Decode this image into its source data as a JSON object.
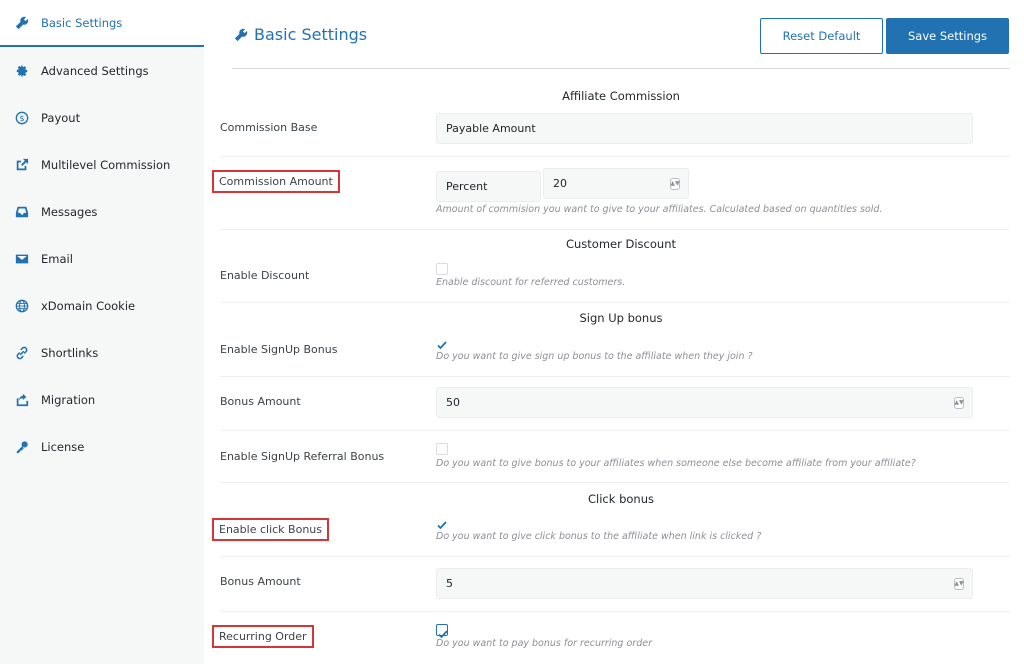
{
  "sidebar": {
    "items": [
      {
        "label": "Basic Settings",
        "icon": "wrench-icon"
      },
      {
        "label": "Advanced Settings",
        "icon": "gear-icon"
      },
      {
        "label": "Payout",
        "icon": "dollar-icon"
      },
      {
        "label": "Multilevel Commission",
        "icon": "external-link-icon"
      },
      {
        "label": "Messages",
        "icon": "inbox-icon"
      },
      {
        "label": "Email",
        "icon": "envelope-icon"
      },
      {
        "label": "xDomain Cookie",
        "icon": "globe-icon"
      },
      {
        "label": "Shortlinks",
        "icon": "link-icon"
      },
      {
        "label": "Migration",
        "icon": "export-icon"
      },
      {
        "label": "License",
        "icon": "key-icon"
      }
    ],
    "active": "Basic Settings"
  },
  "header": {
    "title": "Basic Settings",
    "reset_label": "Reset Default",
    "save_label": "Save Settings"
  },
  "sections": {
    "affiliate_commission": "Affiliate Commission",
    "customer_discount": "Customer Discount",
    "signup_bonus": "Sign Up bonus",
    "click_bonus": "Click bonus"
  },
  "fields": {
    "commission_base": {
      "label": "Commission Base",
      "value": "Payable Amount"
    },
    "commission_amount": {
      "label": "Commission Amount",
      "type": "Percent",
      "value": "20",
      "help": "Amount of commision you want to give to your affiliates. Calculated based on quantities sold."
    },
    "enable_discount": {
      "label": "Enable Discount",
      "checked": false,
      "help": "Enable discount for referred customers."
    },
    "enable_signup_bonus": {
      "label": "Enable SignUp Bonus",
      "checked": true,
      "help": "Do you want to give sign up bonus to the affiliate when they join ?"
    },
    "signup_bonus_amount": {
      "label": "Bonus Amount",
      "value": "50"
    },
    "enable_signup_referral_bonus": {
      "label": "Enable SignUp Referral Bonus",
      "checked": false,
      "help": "Do you want to give bonus to your affiliates when someone else become affiliate from your affiliate?"
    },
    "enable_click_bonus": {
      "label": "Enable click Bonus",
      "checked": true,
      "help": "Do you want to give click bonus to the affiliate when link is clicked ?"
    },
    "click_bonus_amount": {
      "label": "Bonus Amount",
      "value": "5"
    },
    "recurring_order": {
      "label": "Recurring Order",
      "checked": true,
      "help": "Do you want to pay bonus for recurring order"
    }
  },
  "colors": {
    "accent": "#2271b1",
    "highlight": "#d63638"
  }
}
